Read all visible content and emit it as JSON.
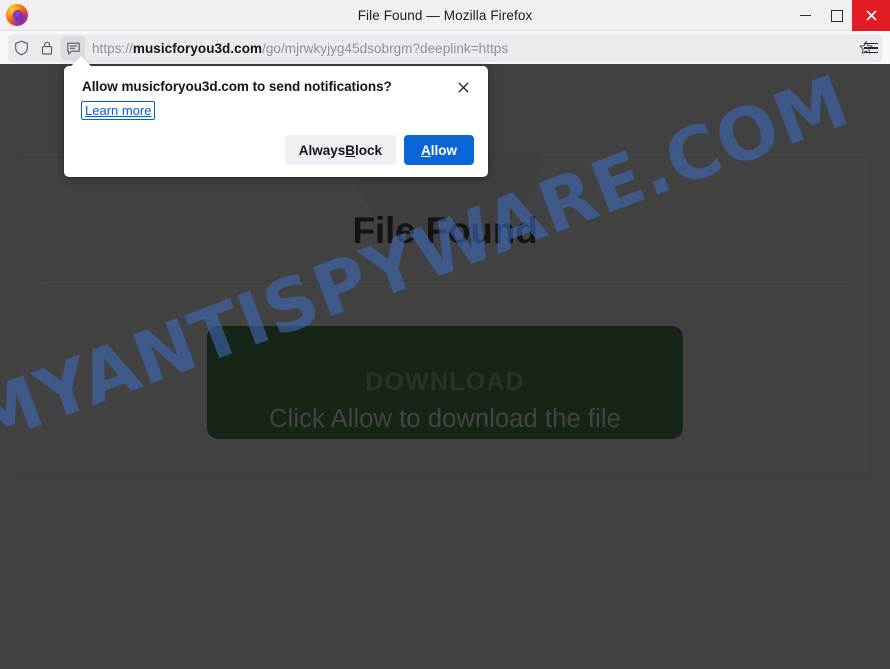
{
  "window": {
    "title": "File Found — Mozilla Firefox",
    "logo_icon": "firefox-logo",
    "controls": {
      "minimize": "minimize-icon",
      "maximize": "maximize-icon",
      "close": "close-icon"
    }
  },
  "navbar": {
    "shield_icon": "shield-icon",
    "lock_icon": "padlock-icon",
    "permission_icon": "notification-bubble-icon",
    "bookmark_icon": "star-icon",
    "menu_icon": "hamburger-menu-icon",
    "url": {
      "scheme": "https://",
      "host": "musicforyou3d.com",
      "path": "/go/mjrwkyjyg45dsobrgm?deeplink=https",
      "full": "https://musicforyou3d.com/go/mjrwkyjyg45dsobrgm?deeplink=https"
    }
  },
  "permission_prompt": {
    "title": "Allow musicforyou3d.com to send notifications?",
    "learn_more": "Learn more",
    "close_icon": "close-icon",
    "block_button": {
      "pre": "Always ",
      "accesskey": "B",
      "post": "lock"
    },
    "allow_button": {
      "accesskey": "A",
      "post": "llow"
    },
    "accent_color": "#0a66d6"
  },
  "page": {
    "heading": "File Found",
    "download_button_label": "DOWNLOAD",
    "caption": "Click Allow to download the file",
    "hero_icon": "package-box-icon",
    "download_button_color": "#1f6b1f",
    "background_color": "#333333"
  },
  "watermark": {
    "text": "MYANTISPYWARE.COM",
    "color": "#3e68b4"
  }
}
